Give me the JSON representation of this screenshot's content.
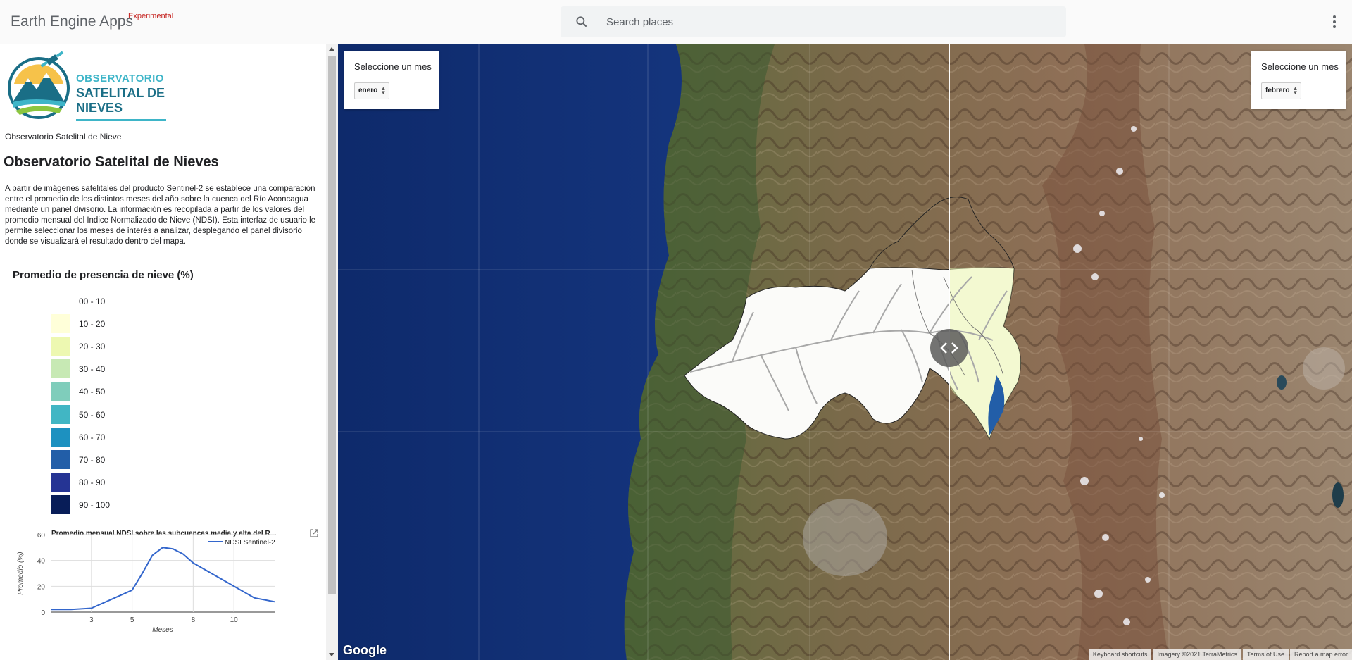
{
  "header": {
    "app_title": "Earth Engine Apps",
    "badge": "Experimental",
    "search_placeholder": "Search places"
  },
  "sidepanel": {
    "logo": {
      "line1": "OBSERVATORIO",
      "line2": "SATELITAL DE",
      "line3": "NIEVES"
    },
    "caption": "Observatorio Satelital de Nieve",
    "title": "Observatorio Satelital de Nieves",
    "description": "A partir de imágenes satelitales del producto Sentinel-2 se establece una comparación entre el promedio de los distintos meses del año sobre la cuenca del Río Aconcagua mediante un panel divisorio. La información es recopilada a partir de los valores del promedio mensual del Indice Normalizado de Nieve (NDSI). Esta interfaz de usuario le permite seleccionar los meses de interés a analizar, desplegando el panel divisorio donde se visualizará el resultado dentro del mapa.",
    "legend_title": "Promedio de presencia de nieve (%)",
    "legend": [
      {
        "label": "00 - 10",
        "color": "#ffffff"
      },
      {
        "label": "10 - 20",
        "color": "#ffffd9"
      },
      {
        "label": "20 - 30",
        "color": "#edf8b1"
      },
      {
        "label": "30 - 40",
        "color": "#c7e9b4"
      },
      {
        "label": "40 - 50",
        "color": "#7fcdbb"
      },
      {
        "label": "50 - 60",
        "color": "#41b6c4"
      },
      {
        "label": "60 - 70",
        "color": "#1d91c0"
      },
      {
        "label": "70 - 80",
        "color": "#225ea8"
      },
      {
        "label": "80 - 90",
        "color": "#253494"
      },
      {
        "label": "90 - 100",
        "color": "#081d58"
      }
    ]
  },
  "map": {
    "left_panel": {
      "label": "Seleccione un mes",
      "selected": "enero"
    },
    "right_panel": {
      "label": "Seleccione un mes",
      "selected": "febrero"
    },
    "google_logo": "Google",
    "footer": [
      "Keyboard shortcuts",
      "Imagery ©2021 TerraMetrics",
      "Terms of Use",
      "Report a map error"
    ]
  },
  "chart_data": {
    "type": "line",
    "title": "Promedio mensual NDSI sobre las subcuencas media y alta del R...",
    "xlabel": "Meses",
    "ylabel": "Promedio (%)",
    "xlim": [
      1,
      12
    ],
    "ylim": [
      0,
      60
    ],
    "xticks": [
      3,
      5,
      8,
      10
    ],
    "yticks": [
      0,
      20,
      40,
      60
    ],
    "grid": true,
    "legend_position": "top-right",
    "series": [
      {
        "name": "NDSI Sentinel-2",
        "color": "#3366cc",
        "x": [
          1,
          2,
          3,
          4,
          5,
          5.5,
          6,
          6.5,
          7,
          7.5,
          8,
          9,
          10,
          11,
          12
        ],
        "y": [
          2,
          2,
          3,
          10,
          17,
          30,
          44,
          50,
          49,
          45,
          38,
          29,
          20,
          11,
          8
        ]
      }
    ]
  }
}
